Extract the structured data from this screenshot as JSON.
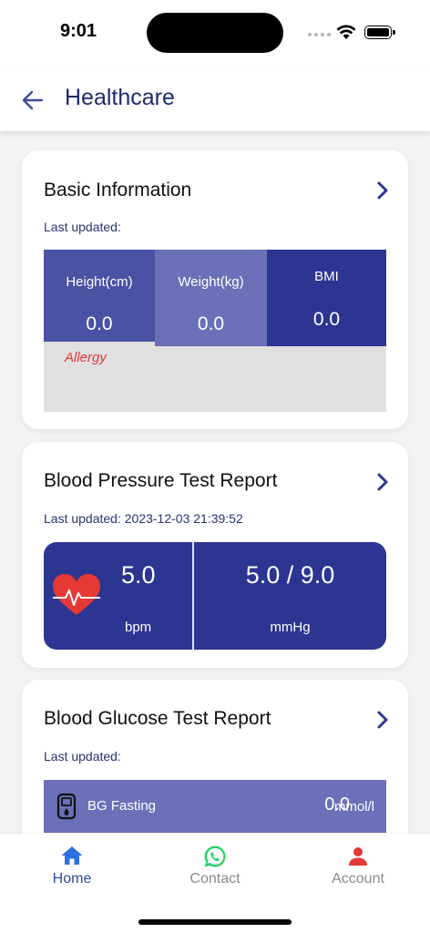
{
  "status_bar": {
    "time": "9:01"
  },
  "header": {
    "title": "Healthcare"
  },
  "basic_info": {
    "title": "Basic Information",
    "last_updated": "Last updated:",
    "height": {
      "label": "Height(cm)",
      "value": "0.0"
    },
    "weight": {
      "label": "Weight(kg)",
      "value": "0.0"
    },
    "bmi": {
      "label": "BMI",
      "value": "0.0"
    },
    "allergy_label": "Allergy"
  },
  "blood_pressure": {
    "title": "Blood Pressure Test Report",
    "last_updated": "Last updated: 2023-12-03 21:39:52",
    "heart_rate": {
      "value": "5.0",
      "unit": "bpm"
    },
    "pressure": {
      "value": "5.0 / 9.0",
      "unit": "mmHg"
    }
  },
  "blood_glucose": {
    "title": "Blood Glucose Test Report",
    "last_updated": "Last updated:",
    "fasting": {
      "label": "BG Fasting",
      "value": "0.0",
      "unit": "mmol/l"
    }
  },
  "bottom_nav": {
    "items": [
      {
        "label": "Home",
        "icon": "home-icon"
      },
      {
        "label": "Contact",
        "icon": "whatsapp-icon"
      },
      {
        "label": "Account",
        "icon": "person-icon"
      }
    ]
  },
  "colors": {
    "primary_dark": "#2c3591",
    "primary_mid": "#4a52a3",
    "primary_light": "#6b70b8",
    "alert_red": "#e53935",
    "whatsapp_green": "#25d366"
  }
}
